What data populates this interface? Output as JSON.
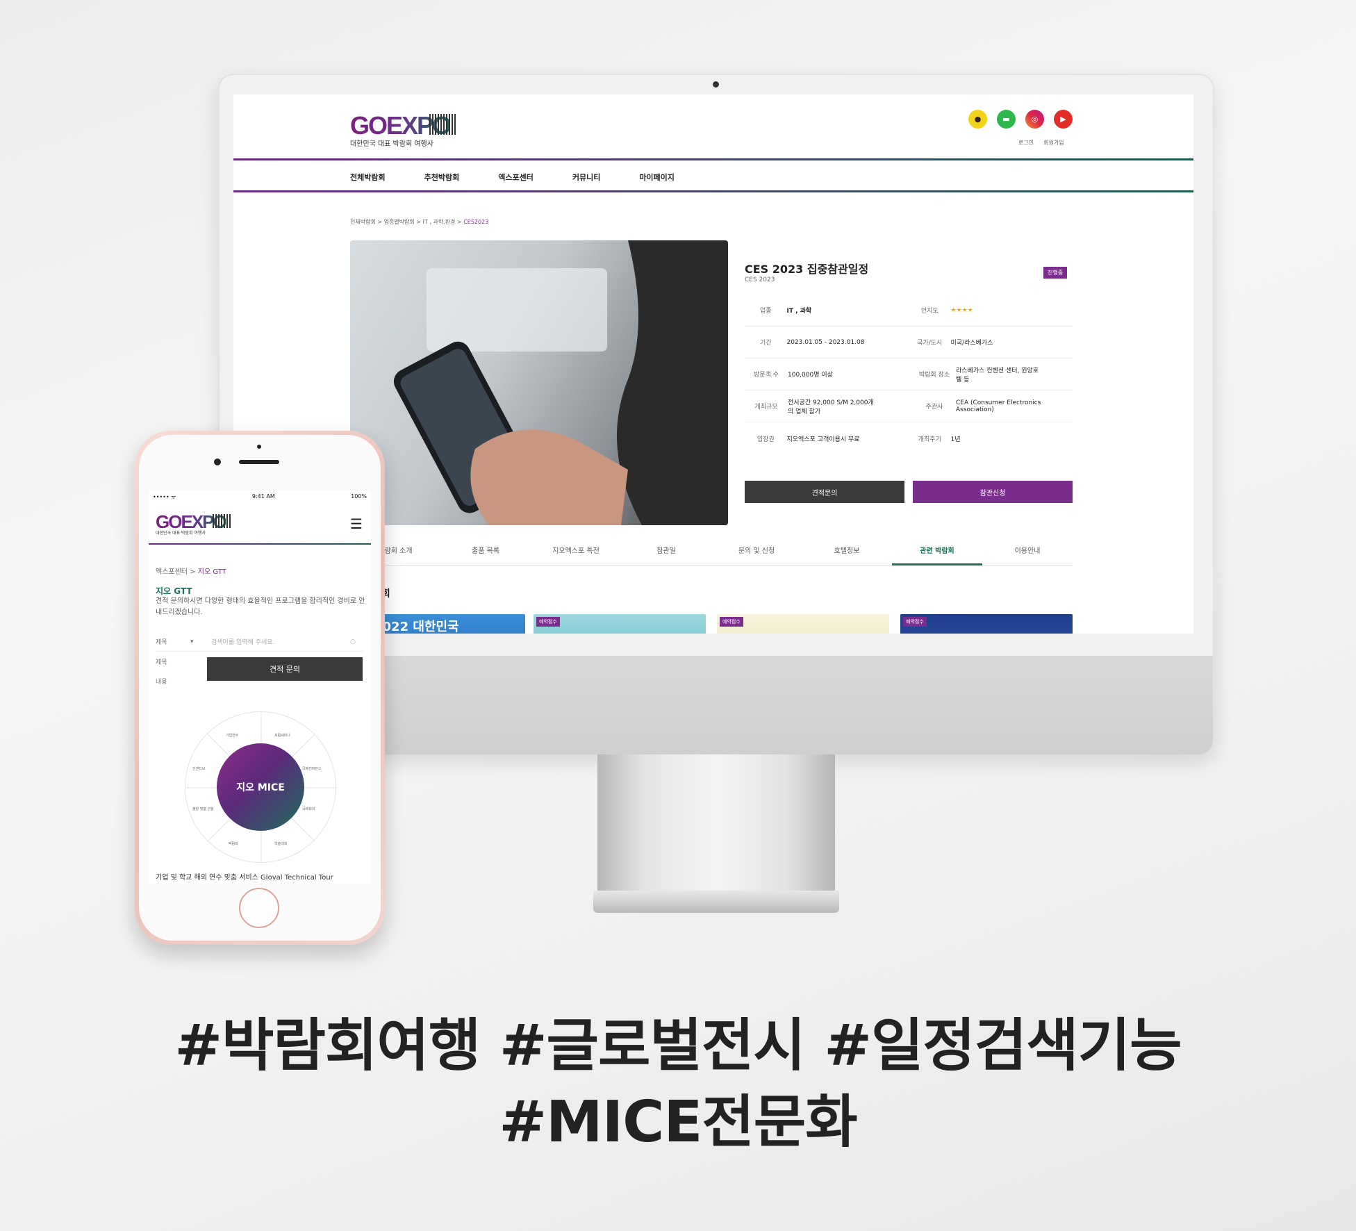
{
  "site": {
    "logo": "GOEXPO",
    "logo_sub": "대한민국 대표 박람회 여행사",
    "social_icons": [
      "kakaotalk-icon",
      "naver-talk-icon",
      "instagram-icon",
      "youtube-icon"
    ],
    "top_links": [
      "로그인",
      "회원가입"
    ],
    "nav": [
      "전체박람회",
      "추천박람회",
      "엑스포센터",
      "커뮤니티",
      "마이페이지"
    ],
    "breadcrumb": "전체박람회 > 업종별박람회 > IT , 과학,환경 > ",
    "breadcrumb_current": "CES2023",
    "title": "CES 2023 집중참관일정",
    "subtitle": "CES 2023",
    "status": "진행중",
    "info": [
      {
        "label": "업종",
        "value": "IT , 과학",
        "label2": "인지도",
        "value2": "★★★★"
      },
      {
        "label": "기간",
        "value": "2023.01.05 - 2023.01.08",
        "label2": "국가/도시",
        "value2": "미국/라스베가스"
      },
      {
        "label": "방문객 수",
        "value": "100,000명 이상",
        "label2": "박람회 장소",
        "value2": "라스베가스 컨벤션 센터, 윈앙호텔 등"
      },
      {
        "label": "개최규모",
        "value": "전시공간 92,000 S/M 2,000개의 업체 참가",
        "label2": "주관사",
        "value2": "CEA (Consumer Electronics Association)"
      },
      {
        "label": "입장권",
        "value": "지오엑스포 고객이용시 무료",
        "label2": "개최주기",
        "value2": "1년"
      }
    ],
    "btn_quote": "견적문의",
    "btn_apply": "참관신청",
    "tabs": [
      "박람회 소개",
      "출품 목록",
      "지오엑스포 특전",
      "참관일",
      "문의 및 신청",
      "호텔정보",
      "관련 박람회",
      "이용안내"
    ],
    "active_tab": "관련 박람회",
    "related_heading": "람회",
    "card_badge": "예약접수",
    "card1_text": "2022 대한민국"
  },
  "phone": {
    "status_left": "••••• ᯤ",
    "status_time": "9:41 AM",
    "status_right": "100%",
    "logo": "GOEXPO",
    "logo_sub": "대한민국 대표 박람회 여행사",
    "menu_icon": "☰",
    "breadcrumb": "엑스포센터 > ",
    "breadcrumb_current": "지오 GTT",
    "heading": "지오 GTT",
    "desc": "견적 문의하시면 다양한 형태의 효율적인 프로그램을 합리적인 경비로 안내드리겠습니다.",
    "form": [
      {
        "label": "제목",
        "placeholder": "검색어를 입력해 주세요."
      },
      {
        "label": "제목",
        "placeholder": ""
      },
      {
        "label": "내용",
        "placeholder": ""
      }
    ],
    "quote_btn": "견적 문의",
    "wheel_center": "지오 MICE",
    "wheel_labels": [
      "기업연수",
      "포럼세미나",
      "국제회의",
      "학술대회",
      "박람회",
      "인센티브",
      "출장 맞춤 관광",
      "국제컨퍼런스"
    ],
    "footer": "기업 및 학교 해외 연수 맞춤 서비스 Gloval Technical Tour"
  },
  "hashtags": {
    "line1": "#박람회여행 #글로벌전시 #일정검색기능",
    "line2": "#MICE전문화"
  },
  "colors": {
    "accent": "#7b2d8e",
    "accent2": "#1e6e5a",
    "dark": "#3a3a3a"
  }
}
